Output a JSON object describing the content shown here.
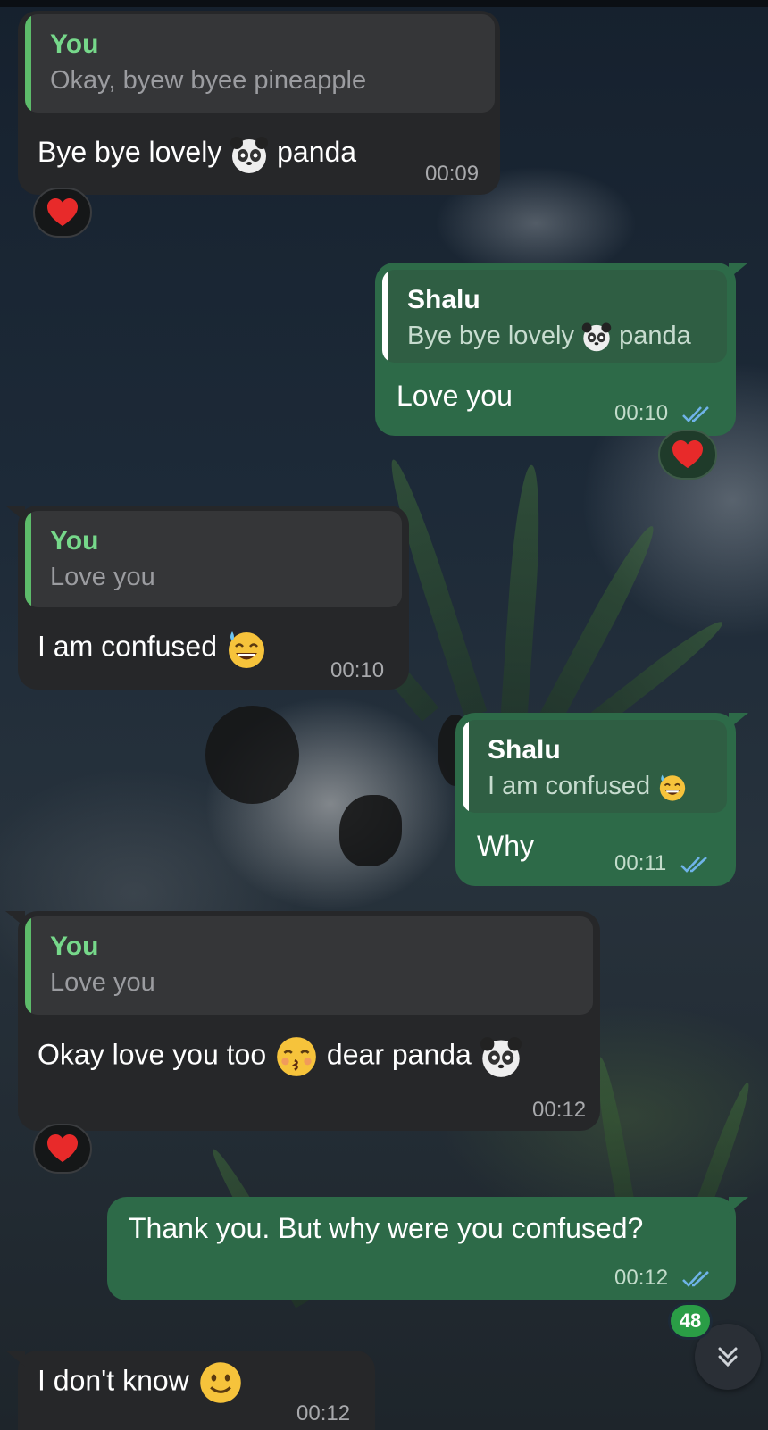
{
  "messages": [
    {
      "id": "m1",
      "direction": "incoming",
      "reply_to": {
        "name": "You",
        "text": "Okay, byew byee pineapple"
      },
      "text_before": "Bye bye lovely",
      "emoji1": "panda-emoji",
      "text_after": "panda",
      "time": "00:09",
      "reaction": "heart"
    },
    {
      "id": "m2",
      "direction": "outgoing",
      "reply_to": {
        "name": "Shalu",
        "text_before": "Bye bye lovely",
        "emoji": "panda-emoji",
        "text_after": "panda"
      },
      "text": "Love you",
      "time": "00:10",
      "status": "read",
      "reaction": "heart"
    },
    {
      "id": "m3",
      "direction": "incoming",
      "reply_to": {
        "name": "You",
        "text": "Love you"
      },
      "text": "I am confused",
      "emoji1": "grinning-sweat-emoji",
      "time": "00:10"
    },
    {
      "id": "m4",
      "direction": "outgoing",
      "reply_to": {
        "name": "Shalu",
        "text": "I am confused",
        "emoji": "grinning-sweat-emoji"
      },
      "text": "Why",
      "time": "00:11",
      "status": "read"
    },
    {
      "id": "m5",
      "direction": "incoming",
      "reply_to": {
        "name": "You",
        "text": "Love you"
      },
      "text_before": "Okay love you too",
      "emoji1": "kissing-emoji",
      "text_middle": "dear panda",
      "emoji2": "panda-emoji",
      "time": "00:12",
      "reaction": "heart"
    },
    {
      "id": "m6",
      "direction": "outgoing",
      "text": "Thank you. But why were you confused?",
      "time": "00:12",
      "status": "read"
    },
    {
      "id": "m7",
      "direction": "incoming",
      "text": "I don't know",
      "emoji1": "slightly-smiling-emoji",
      "time": "00:12"
    }
  ],
  "scroll_down": {
    "unread_count": "48",
    "icon": "double-chevron-down-icon"
  },
  "colors": {
    "incoming": "#262729",
    "outgoing": "#2d6a48",
    "accent_incoming": "#76d88a",
    "read_check": "#6fb3e8",
    "badge": "#2a9d46"
  }
}
